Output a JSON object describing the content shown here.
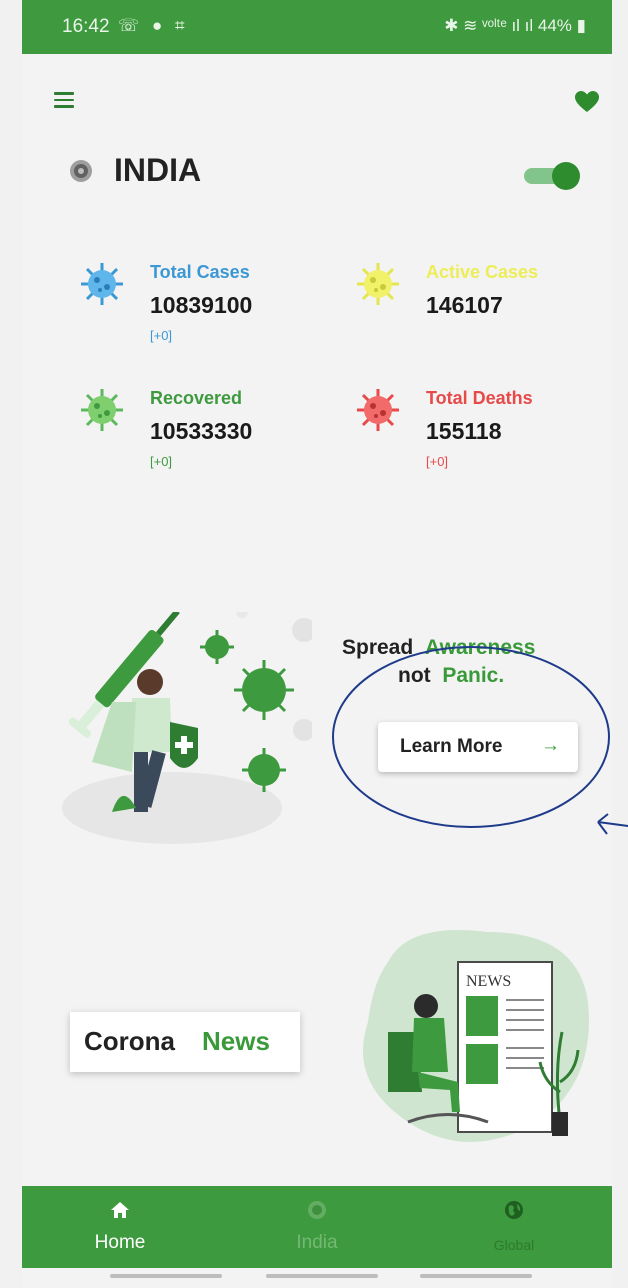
{
  "status_bar": {
    "time": "16:42",
    "left_icons": "☏ ● ⌗",
    "right_text": "✱ ≋ ᵛᵒˡᵗᵉ ıl ıl 44% ▮"
  },
  "header": {
    "menu_icon": "hamburger-icon",
    "favorite_icon": "heart-icon",
    "country": "INDIA",
    "toggle_on": true
  },
  "stats": {
    "total_cases": {
      "label": "Total Cases",
      "value": "10839100",
      "delta": "[+0]",
      "color": "#3c98d4"
    },
    "active_cases": {
      "label": "Active Cases",
      "value": "146107",
      "color": "#eded58"
    },
    "recovered": {
      "label": "Recovered",
      "value": "10533330",
      "delta": "[+0]",
      "color": "#3e9a3e"
    },
    "total_deaths": {
      "label": "Total Deaths",
      "value": "155118",
      "delta": "[+0]",
      "color": "#e84a4a"
    }
  },
  "awareness": {
    "word1": "Spread",
    "word2": "Awareness",
    "word3": "not",
    "word4": "Panic.",
    "button_label": "Learn More",
    "button_arrow": "→"
  },
  "news": {
    "word1": "Corona",
    "word2": "News",
    "sign_text": "NEWS"
  },
  "bottom_nav": {
    "home": "Home",
    "india": "India",
    "global": "Global"
  },
  "colors": {
    "primary_green": "#3e9a3e",
    "annotation_blue": "#1e3a8a"
  }
}
